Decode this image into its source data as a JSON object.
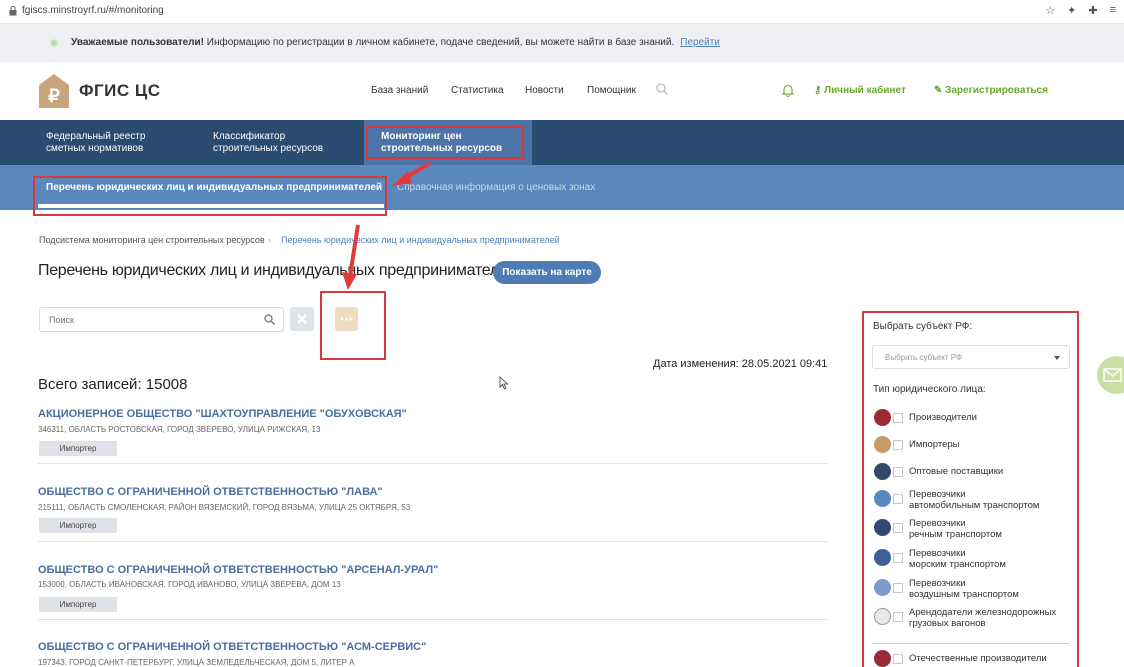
{
  "browser": {
    "url": "fgiscs.minstroyrf.ru/#/monitoring"
  },
  "notice": {
    "bold": "Уважаемые пользователи!",
    "text": " Информацию по регистрации в личном кабинете, подаче сведений, вы можете найти в базе знаний.",
    "link": "Перейти"
  },
  "header": {
    "logo_text": "ФГИС ЦС",
    "nav": [
      "База знаний",
      "Статистика",
      "Новости",
      "Помощник"
    ],
    "cabinet": "Личный кабинет",
    "register": "Зарегистрироваться"
  },
  "main_menu": [
    {
      "line1": "Федеральный реестр",
      "line2": "сметных нормативов"
    },
    {
      "line1": "Классификатор",
      "line2": "строительных ресурсов"
    },
    {
      "line1": "Мониторинг цен",
      "line2": "строительных ресурсов"
    }
  ],
  "sub_menu": {
    "active": "Перечень юридических лиц и индивидуальных предпринимателей",
    "other": "Справочная информация о ценовых зонах"
  },
  "breadcrumb": {
    "root": "Подсистема мониторинга цен строительных ресурсов",
    "current": "Перечень юридических лиц и индивидуальных предпринимателей"
  },
  "page": {
    "title": "Перечень юридических лиц и индивидуальных предпринимателей",
    "map_button": "Показать на карте",
    "search_placeholder": "Поиск",
    "date_change": "Дата изменения: 28.05.2021 09:41",
    "total": "Всего записей: 15008"
  },
  "records": [
    {
      "name": "АКЦИОНЕРНОЕ ОБЩЕСТВО \"ШАХТОУПРАВЛЕНИЕ \"ОБУХОВСКАЯ\"",
      "address": "346311, ОБЛАСТЬ РОСТОВСКАЯ, ГОРОД ЗВЕРЕВО, УЛИЦА РИЖСКАЯ, 13",
      "tag": "Импортер"
    },
    {
      "name": "ОБЩЕСТВО С ОГРАНИЧЕННОЙ ОТВЕТСТВЕННОСТЬЮ \"ЛАВА\"",
      "address": "215111, ОБЛАСТЬ СМОЛЕНСКАЯ, РАЙОН ВЯЗЕМСКИЙ, ГОРОД ВЯЗЬМА, УЛИЦА 25 ОКТЯБРЯ, 53",
      "tag": "Импортер"
    },
    {
      "name": "ОБЩЕСТВО С ОГРАНИЧЕННОЙ ОТВЕТСТВЕННОСТЬЮ \"АРСЕНАЛ-УРАЛ\"",
      "address": "153000, ОБЛАСТЬ ИВАНОВСКАЯ, ГОРОД ИВАНОВО, УЛИЦА ЗВЕРЕВА, ДОМ 13",
      "tag": "Импортер"
    },
    {
      "name": "ОБЩЕСТВО С ОГРАНИЧЕННОЙ ОТВЕТСТВЕННОСТЬЮ \"АСМ-СЕРВИС\"",
      "address": "197343, ГОРОД САНКТ-ПЕТЕРБУРГ, УЛИЦА ЗЕМЛЕДЕЛЬЧЕСКАЯ, ДОМ 5, ЛИТЕР А",
      "tag": ""
    }
  ],
  "filter": {
    "subject_label": "Выбрать субъект РФ:",
    "subject_placeholder": "Выбрать субъект РФ",
    "type_label": "Тип юридического лица:",
    "types": [
      {
        "line1": "Производители",
        "line2": "",
        "color": "#9b2a35"
      },
      {
        "line1": "Импортеры",
        "line2": "",
        "color": "#c79a6c"
      },
      {
        "line1": "Оптовые поставщики",
        "line2": "",
        "color": "#33486a"
      },
      {
        "line1": "Перевозчики",
        "line2": "автомобильным транспортом",
        "color": "#5a86c2"
      },
      {
        "line1": "Перевозчики",
        "line2": "речным транспортом",
        "color": "#2e4a75"
      },
      {
        "line1": "Перевозчики",
        "line2": "морским транспортом",
        "color": "#3d5f95"
      },
      {
        "line1": "Перевозчики",
        "line2": "воздушным транспортом",
        "color": "#7d9bc9"
      },
      {
        "line1": "Арендодатели железнодорожных",
        "line2": "грузовых вагонов",
        "color": "#e8e8e8"
      }
    ],
    "domestic": "Отечественные производители"
  }
}
